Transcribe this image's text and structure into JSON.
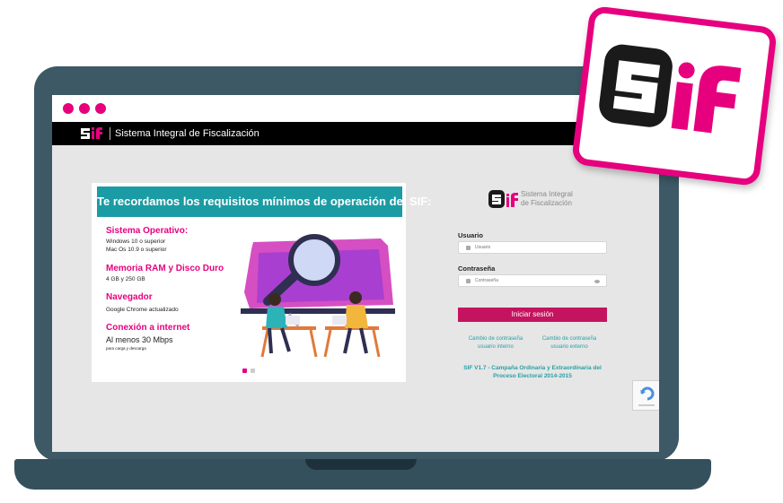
{
  "header": {
    "title": "Sistema Integral de Fiscalización"
  },
  "banner": {
    "title": "Te recordamos los requisitos mínimos de operación del SIF:"
  },
  "requirements": {
    "os_heading": "Sistema Operativo:",
    "os_line1": "Windows 10 o superior",
    "os_line2": "Mac Os 10.9 o superior",
    "ram_heading": "Memoria RAM y Disco Duro",
    "ram_text": "4 GB y 250 GB",
    "browser_heading": "Navegador",
    "browser_text": "Google Chrome actualizado",
    "internet_heading": "Conexión a internet",
    "internet_text": "Al menos 30 Mbps",
    "internet_note": "para carga y descarga"
  },
  "login": {
    "brand_line1": "Sistema Integral",
    "brand_line2": "de Fiscalización",
    "user_label": "Usuario",
    "user_placeholder": "Usuario",
    "password_label": "Contraseña",
    "password_placeholder": "Contraseña",
    "submit_label": "Iniciar sesión",
    "link_left": "Cambio de contraseña usuario interno",
    "link_right": "Cambio de contraseña usuario externo",
    "footer": "SIF V1.7 - Campaña Ordinaria y Extraordinaria del Proceso Electoral 2014-2015"
  },
  "colors": {
    "accent": "#e6007e",
    "teal": "#1b9ca4",
    "button": "#c5145f",
    "bezel": "#3d5966"
  }
}
